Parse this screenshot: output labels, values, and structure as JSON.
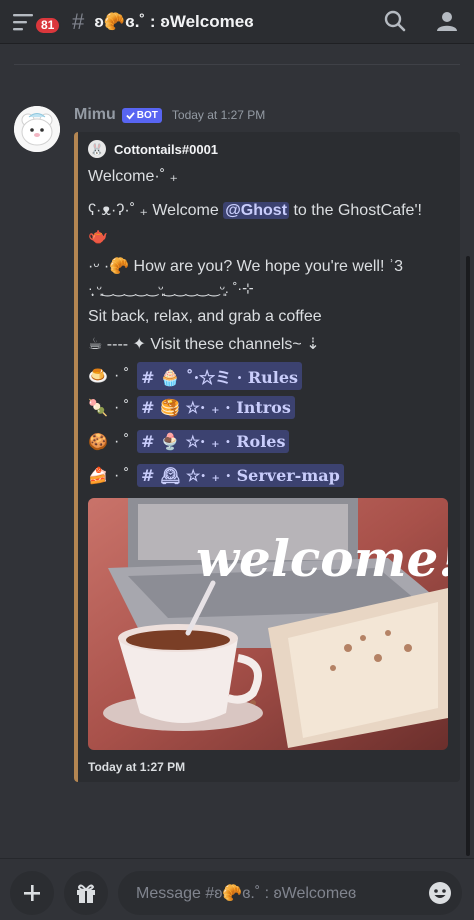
{
  "header": {
    "badge_count": "81",
    "channel_hash": "#",
    "channel_name": "ʚ🥐ɞ.˚ : ʚWelcomeɞ",
    "icons": [
      "menu-icon",
      "search-icon",
      "members-icon"
    ]
  },
  "message": {
    "author": "Mimu",
    "bot_label": "BOT",
    "timestamp": "Today at 1:27 PM"
  },
  "embed": {
    "accent_color": "#b48652",
    "author_name": "Cottontails#0001",
    "line1": "Welcome·˚ ₊",
    "line2_pre": "ʕ·ᴥ·ʔ·˚ ₊ Welcome ",
    "mention": "@Ghost",
    "line2_post": " to the GhostCafe'!",
    "line3": "🫖",
    "line4": "·ᵕ ·🥐 How are you? We hope you're well! ʾ3",
    "line5": "·̩͙ ᵕ͈‿‿‿‿‿ᵕ͈‿‿‿‿‿ᵕ͈. ˚·⊹",
    "line6": "Sit back, relax, and grab a coffee",
    "line7": "☕ ---- ✦ Visit these channels~ ⇣",
    "channels": [
      {
        "emoji": "🍮",
        "label": "# 🧁 ˚·☆ミ · Rules"
      },
      {
        "emoji": "🍡",
        "label": "# 🥞 ☆· ₊ · Intros"
      },
      {
        "emoji": "🍪",
        "label": "# 🍨 ☆· ₊ · Roles"
      },
      {
        "emoji": "🍰",
        "label": "# 🕰 ☆· ₊ · Server-map"
      }
    ],
    "channel_sep": "· ˚",
    "image_text": "welcome!",
    "footer": "Today at 1:27 PM"
  },
  "composer": {
    "placeholder": "Message #ʚ🥐ɞ.˚ : ʚWelcomeɞ",
    "icons": [
      "plus-icon",
      "gift-icon",
      "emoji-icon"
    ]
  }
}
